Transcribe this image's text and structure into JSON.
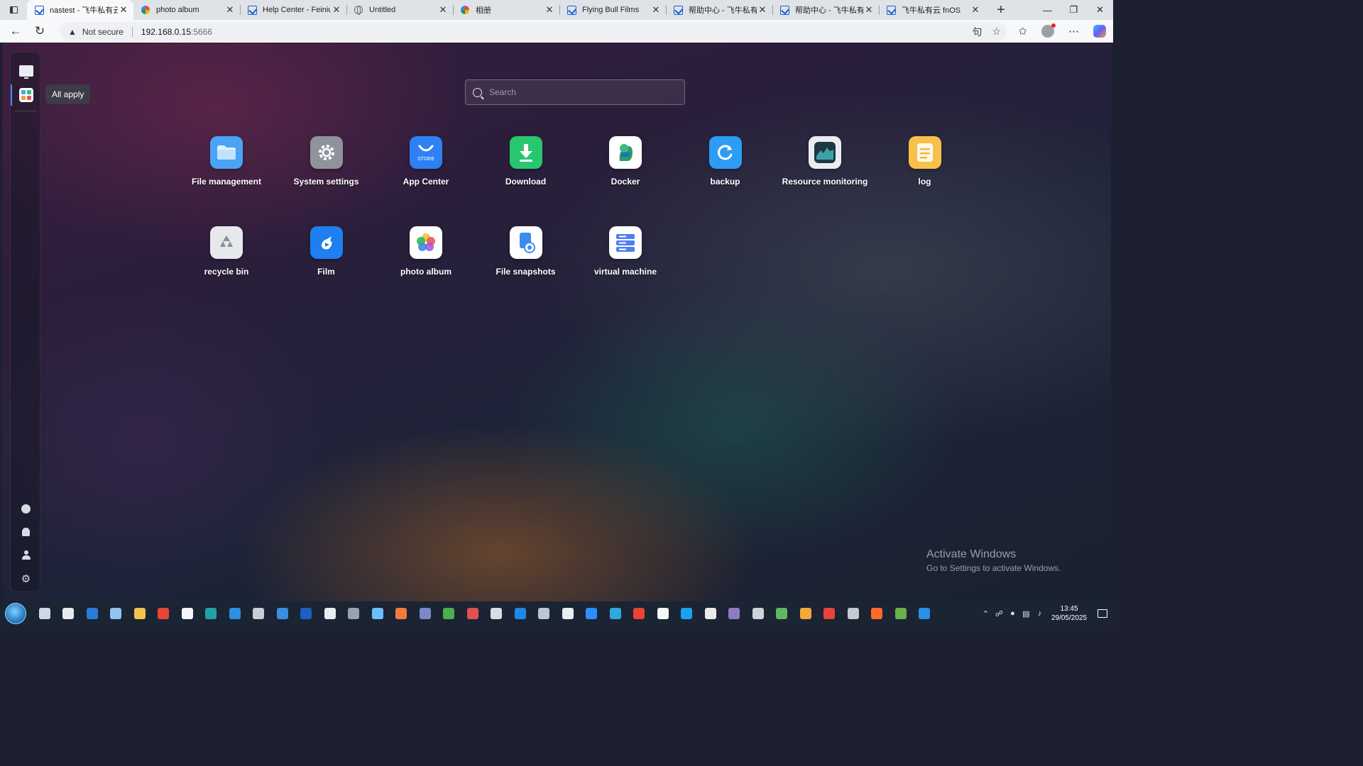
{
  "browser": {
    "tabs": [
      {
        "title": "nastest - 飞牛私有云fnOS",
        "favicon": "feiniu-icon",
        "active": true
      },
      {
        "title": "photo album",
        "favicon": "pinwheel-icon",
        "active": false
      },
      {
        "title": "Help Center - Feiniu Private Cloud",
        "favicon": "feiniu-icon",
        "active": false
      },
      {
        "title": "Untitled",
        "favicon": "globe-icon",
        "active": false
      },
      {
        "title": "相册",
        "favicon": "pinwheel-icon",
        "active": false
      },
      {
        "title": "Flying Bull Films",
        "favicon": "feiniu-icon",
        "active": false
      },
      {
        "title": "帮助中心 - 飞牛私有云",
        "favicon": "feiniu-icon",
        "active": false
      },
      {
        "title": "帮助中心 - 飞牛私有云",
        "favicon": "feiniu-icon",
        "active": false
      },
      {
        "title": "飞牛私有云 fnOS",
        "favicon": "feiniu-icon",
        "active": false
      }
    ],
    "address": {
      "security": "Not secure",
      "host": "192.168.0.15",
      "port": ":5666"
    }
  },
  "sidebar": {
    "tooltip": "All apply"
  },
  "search": {
    "placeholder": "Search"
  },
  "apps": [
    {
      "label": "File management",
      "icon": "folder-icon",
      "color": "#4aa3f5"
    },
    {
      "label": "System settings",
      "icon": "gear-icon",
      "color": "#8e939c"
    },
    {
      "label": "App Center",
      "icon": "store-icon",
      "color": "#2f7ff5"
    },
    {
      "label": "Download",
      "icon": "download-icon",
      "color": "#28c76f"
    },
    {
      "label": "Docker",
      "icon": "docker-icon",
      "color": "#ffffff"
    },
    {
      "label": "backup",
      "icon": "backup-icon",
      "color": "#2d9cf5"
    },
    {
      "label": "Resource monitoring",
      "icon": "monitor-icon",
      "color": "#e9edf2"
    },
    {
      "label": "log",
      "icon": "log-icon",
      "color": "#f8c04a"
    },
    {
      "label": "recycle bin",
      "icon": "recycle-icon",
      "color": "#e6e8ec"
    },
    {
      "label": "Film",
      "icon": "film-icon",
      "color": "#1f7ef0"
    },
    {
      "label": "photo album",
      "icon": "photo-icon",
      "color": "#ffffff"
    },
    {
      "label": "File snapshots",
      "icon": "snapshot-icon",
      "color": "#ffffff"
    },
    {
      "label": "virtual machine",
      "icon": "vm-icon",
      "color": "#ffffff"
    }
  ],
  "watermark": {
    "title": "Activate Windows",
    "subtitle": "Go to Settings to activate Windows."
  },
  "taskbar": {
    "time": "13:45",
    "date": "29/05/2025"
  }
}
